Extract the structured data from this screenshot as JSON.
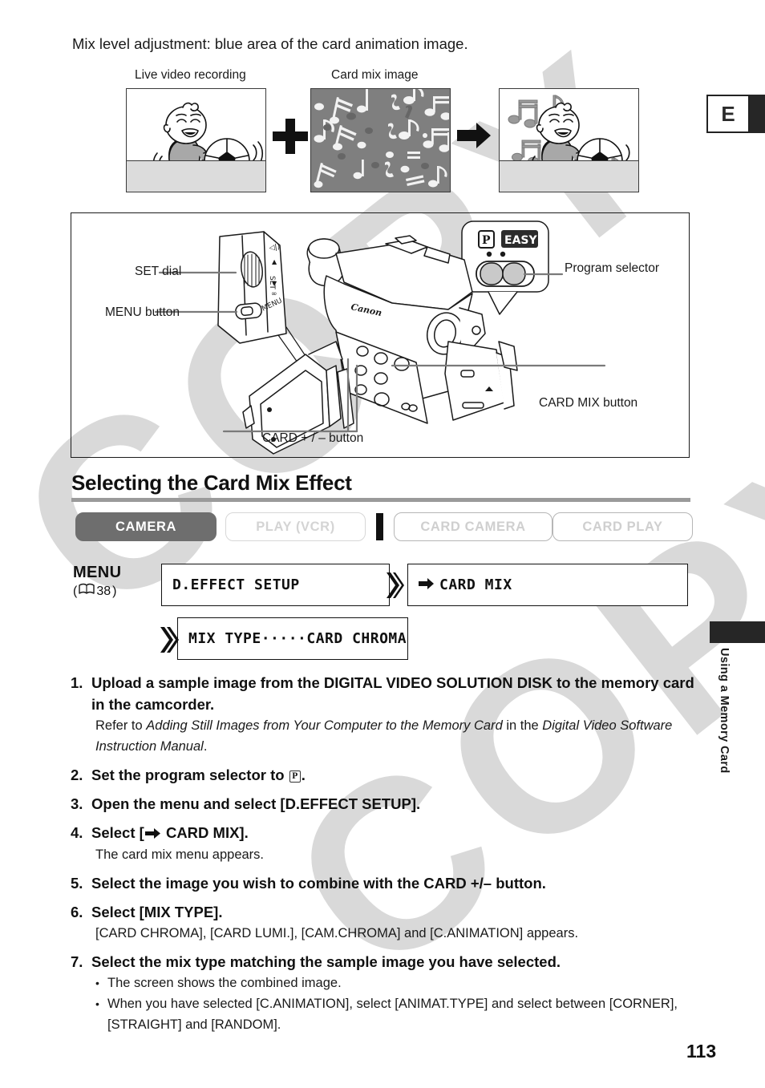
{
  "page": {
    "intro_line": "Mix level adjustment: blue area of the card animation image.",
    "page_number": "113",
    "edition_tab": "E",
    "side_tab_label": "Using a Memory Card",
    "watermark": "COPY"
  },
  "figures": {
    "live_caption": "Live video recording",
    "cardmix_caption": "Card mix image",
    "plus_symbol": "+",
    "arrow_symbol": "→"
  },
  "diagram": {
    "labels": {
      "set_dial": "SET dial",
      "menu_button": "MENU button",
      "program_selector": "Program selector",
      "card_mix_button": "CARD MIX button",
      "card_plus_minus_button": "CARD + / – button"
    },
    "callout": {
      "program_mode": "P",
      "easy_mode": "EASY"
    },
    "body_brand": "Canon",
    "dial_menu_text": "MENU"
  },
  "section": {
    "heading": "Selecting the Card Mix Effect"
  },
  "mode_tabs": [
    {
      "label": "CAMERA",
      "state": "active"
    },
    {
      "label": "PLAY (VCR)",
      "state": "inactive"
    },
    {
      "label": "CARD CAMERA",
      "state": "inactive"
    },
    {
      "label": "CARD PLAY",
      "state": "inactive"
    }
  ],
  "menu_block": {
    "menu_word": "MENU",
    "reference_open": "(",
    "reference_page": "38",
    "reference_close": ")",
    "osd_items": [
      {
        "text": "D.EFFECT SETUP",
        "arrow": false
      },
      {
        "text": "CARD MIX",
        "arrow": true
      },
      {
        "text": "MIX TYPE·····CARD CHROMA",
        "arrow": false
      }
    ]
  },
  "steps": [
    {
      "num": "1.",
      "title": "Upload a sample image from the DIGITAL VIDEO SOLUTION DISK to the memory card in the camcorder.",
      "body_parts": [
        {
          "text": "Refer to ",
          "italic": false
        },
        {
          "text": "Adding Still Images from Your Computer to the Memory Card",
          "italic": true
        },
        {
          "text": " in the ",
          "italic": false
        },
        {
          "text": "Digital Video Software Instruction Manual",
          "italic": true
        },
        {
          "text": ".",
          "italic": false
        }
      ]
    },
    {
      "num": "2.",
      "title_pre": "Set the program selector to ",
      "title_icon": "P",
      "title_post": "."
    },
    {
      "num": "3.",
      "title": "Open the menu and select [D.EFFECT SETUP]."
    },
    {
      "num": "4.",
      "title_pre": "Select [",
      "title_icon": "arrow",
      "title_post": " CARD MIX].",
      "body": "The card mix menu appears."
    },
    {
      "num": "5.",
      "title": "Select the image you wish to combine with the CARD +/– button."
    },
    {
      "num": "6.",
      "title": "Select [MIX TYPE].",
      "body": "[CARD CHROMA], [CARD LUMI.], [CAM.CHROMA] and [C.ANIMATION] appears."
    },
    {
      "num": "7.",
      "title": "Select the mix type matching the sample image you have selected.",
      "bullets": [
        "The screen shows the combined image.",
        "When you have selected [C.ANIMATION], select [ANIMAT.TYPE] and select between [CORNER], [STRAIGHT] and [RANDOM]."
      ]
    }
  ],
  "colors": {
    "active_tab_bg": "#6e6e6e",
    "inactive_tab_border": "#d7d7d7",
    "rule": "#9a9a9a",
    "watermark": "#d9d9d9",
    "side_tab_black": "#262626"
  }
}
